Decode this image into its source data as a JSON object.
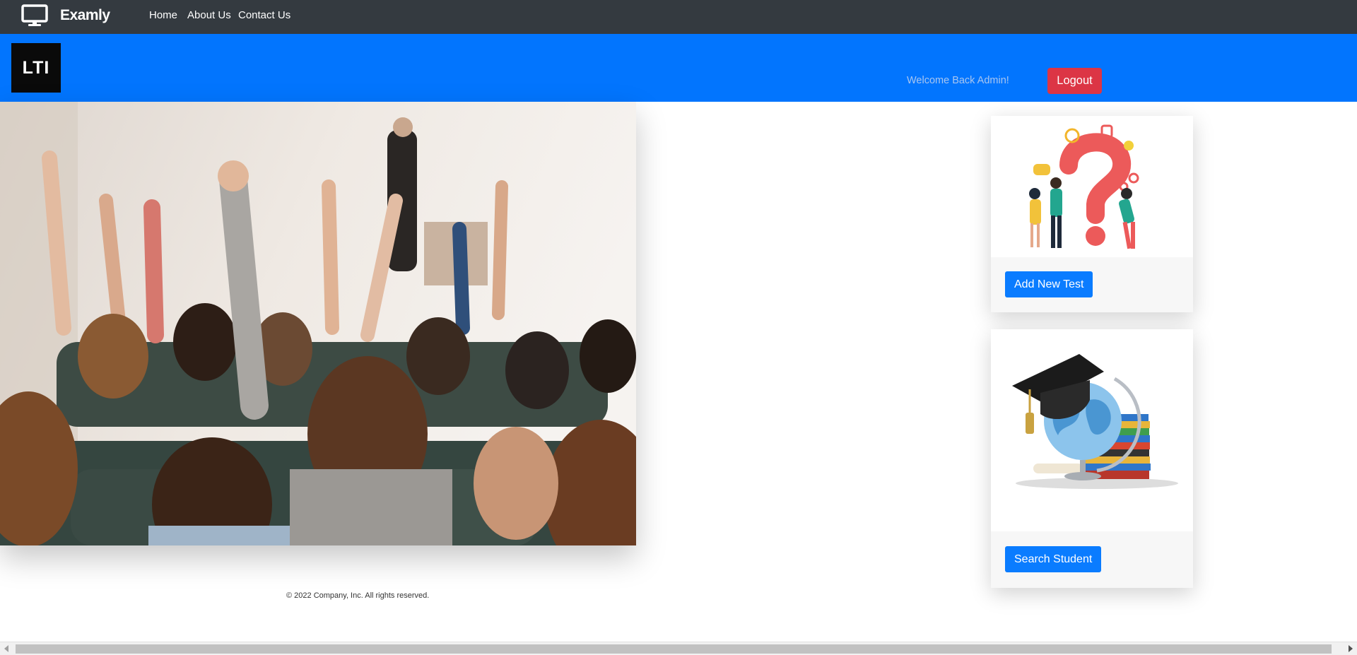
{
  "brand": {
    "name": "Examly",
    "icon": "monitor-icon"
  },
  "nav": {
    "items": [
      {
        "label": "Home"
      },
      {
        "label": "About Us"
      },
      {
        "label": "Contact Us"
      }
    ]
  },
  "header": {
    "logo_text": "LTI",
    "welcome_text": "Welcome Back Admin!",
    "logout_label": "Logout"
  },
  "hero": {
    "image": "students-raising-hands-photo"
  },
  "cards": [
    {
      "image": "question-mark-people-illustration",
      "button_label": "Add New Test"
    },
    {
      "image": "globe-graduation-cap-books-illustration",
      "button_label": "Search Student"
    }
  ],
  "footer": {
    "copyright": "© 2022 Company, Inc. All rights reserved."
  },
  "colors": {
    "topnav": "#343a40",
    "header": "#0275fe",
    "logout": "#dc3545",
    "primary_button": "#0a7cff"
  }
}
